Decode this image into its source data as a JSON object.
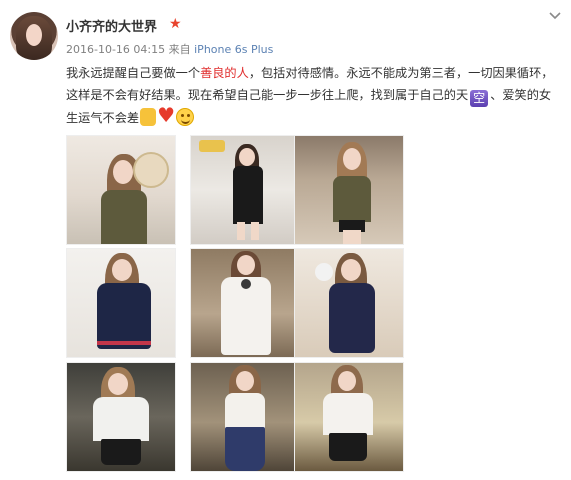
{
  "user": {
    "name": "小齐齐的大世界",
    "badge_icon": "star-icon"
  },
  "meta": {
    "time": "2016-10-16 04:15",
    "from_label": "来自",
    "source": "iPhone 6s Plus"
  },
  "post": {
    "part1": "我永远提醒自己要做一个",
    "highlight": "善良的人",
    "part2": "，包括对待感情。永远不能成为第三者，一切因果循环，这样是不会有好结果。现在希望自己能一步一步往上爬，找到属于自己的天",
    "kong_label": "空",
    "part3": "、爱笑的女生运气不会差",
    "emoji": [
      "rock-hand-icon",
      "heart-icon",
      "smile-icon"
    ]
  },
  "colors": {
    "accent_red": "#e02d2d",
    "star": "#e8432e",
    "source_link": "#5c82b3"
  },
  "photos": [
    {
      "name": "photo-1",
      "theme": "olive-jacket-hat"
    },
    {
      "name": "photo-2",
      "theme": "black-dress-walking"
    },
    {
      "name": "photo-3",
      "theme": "olive-jacket-street"
    },
    {
      "name": "photo-4",
      "theme": "navy-dress-stripe"
    },
    {
      "name": "photo-5",
      "theme": "white-dress-bow"
    },
    {
      "name": "photo-6",
      "theme": "navy-lace-dress"
    },
    {
      "name": "photo-7",
      "theme": "white-blouse-leather-skirt"
    },
    {
      "name": "photo-8",
      "theme": "white-top-floral-pants"
    },
    {
      "name": "photo-9",
      "theme": "white-shirt-black-skirt"
    }
  ]
}
